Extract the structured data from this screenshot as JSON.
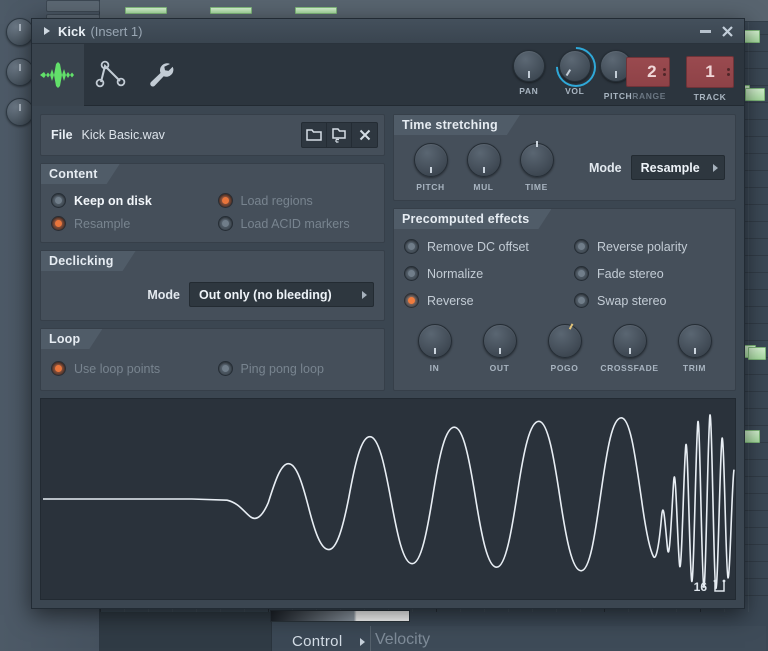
{
  "window": {
    "title": "Kick",
    "subtitle": "(Insert 1)",
    "expand_arrow_icon": "triangle-right-icon",
    "minimize_label": "minimize-icon",
    "close_label": "close-icon"
  },
  "toolbar": {
    "tabs": [
      {
        "id": "sample",
        "icon": "waveform-icon",
        "active": true
      },
      {
        "id": "instrument",
        "icon": "envelope-points-icon",
        "active": false
      },
      {
        "id": "misc",
        "icon": "wrench-icon",
        "active": false
      }
    ],
    "controls": [
      {
        "name": "pan",
        "label": "PAN",
        "type": "knob",
        "angle": 0,
        "ring": false
      },
      {
        "name": "vol",
        "label": "VOL",
        "type": "knob",
        "angle": 30,
        "ring": true
      },
      {
        "name": "pitch",
        "label": "PITCH",
        "type": "knob",
        "angle": 0,
        "ring": false
      }
    ],
    "pitch_range": {
      "label": "RANGE",
      "value": "2"
    },
    "track": {
      "label": "TRACK",
      "value": "1"
    },
    "accent_ring_color": "#2fa8d8",
    "value_box_color": "#9a4a4f"
  },
  "file": {
    "label": "File",
    "name": "Kick Basic.wav",
    "buttons": [
      {
        "name": "open-file-button",
        "icon": "folder-open-icon"
      },
      {
        "name": "save-file-button",
        "icon": "folder-edit-icon"
      },
      {
        "name": "clear-file-button",
        "icon": "close-x-icon"
      }
    ]
  },
  "content": {
    "title": "Content",
    "options": [
      {
        "label": "Keep on disk",
        "state": "enabled-off",
        "column": 0
      },
      {
        "label": "Load regions",
        "state": "disabled-on",
        "column": 1
      },
      {
        "label": "Resample",
        "state": "disabled-on",
        "column": 0
      },
      {
        "label": "Load ACID markers",
        "state": "disabled-off",
        "column": 1
      }
    ]
  },
  "declicking": {
    "title": "Declicking",
    "mode_label": "Mode",
    "mode_value": "Out only (no bleeding)"
  },
  "loop": {
    "title": "Loop",
    "options": [
      {
        "label": "Use loop points",
        "state": "disabled-on"
      },
      {
        "label": "Ping pong loop",
        "state": "disabled-off"
      }
    ]
  },
  "time_stretching": {
    "title": "Time stretching",
    "knobs": [
      {
        "label": "PITCH",
        "angle": 0
      },
      {
        "label": "MUL",
        "angle": 0
      },
      {
        "label": "TIME",
        "angle": 180
      }
    ],
    "mode_label": "Mode",
    "mode_value": "Resample"
  },
  "precomputed_effects": {
    "title": "Precomputed effects",
    "options_left": [
      {
        "label": "Remove DC offset",
        "state": "off"
      },
      {
        "label": "Normalize",
        "state": "off"
      },
      {
        "label": "Reverse",
        "state": "on"
      }
    ],
    "options_right": [
      {
        "label": "Reverse polarity",
        "state": "off"
      },
      {
        "label": "Fade stereo",
        "state": "off"
      },
      {
        "label": "Swap stereo",
        "state": "off"
      }
    ],
    "active_color": "#ef7b3e",
    "knobs": [
      {
        "label": "IN",
        "angle": 0
      },
      {
        "label": "OUT",
        "angle": 0
      },
      {
        "label": "POGO",
        "angle": -150
      },
      {
        "label": "CROSSFADE",
        "angle": 0
      },
      {
        "label": "TRIM",
        "angle": 0
      }
    ]
  },
  "waveform": {
    "channel_count": "16",
    "icon": "wave-zoom-icon",
    "color": "#e8eef4",
    "background": "#2a323b",
    "description": "reversed kick drum: silence then growing oscillation into dense transient burst"
  },
  "background": {
    "control_label": "Control",
    "velocity_label": "Velocity"
  }
}
